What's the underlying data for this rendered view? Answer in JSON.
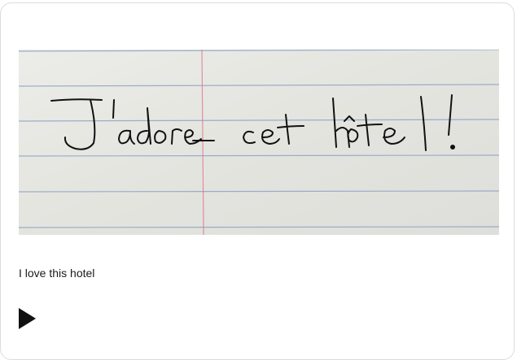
{
  "handwriting_text": "J'adore cet hotel!",
  "caption": "I love this hotel",
  "play_icon": "play-triangle-icon",
  "colors": {
    "paper": "#e6e6e2",
    "rule_line": "#8fa3c4",
    "margin_line": "#e07a8a",
    "ink": "#111111",
    "icon": "#111111"
  }
}
